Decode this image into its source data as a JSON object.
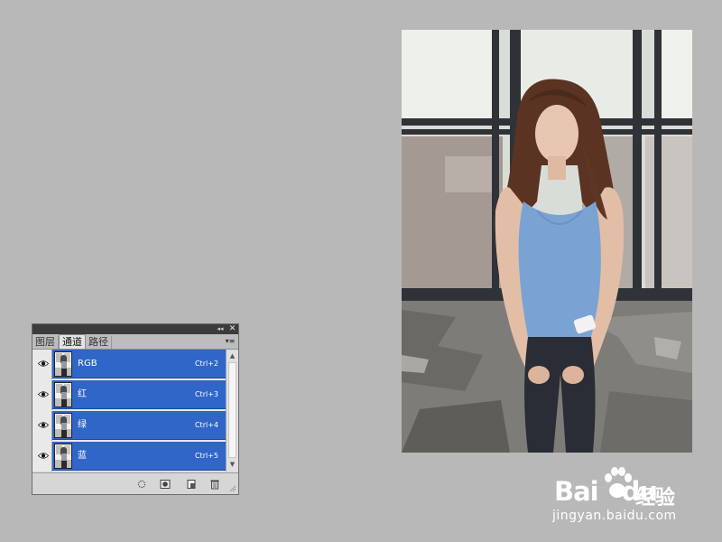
{
  "panel": {
    "tabs": [
      {
        "label": "图层",
        "active": false
      },
      {
        "label": "通道",
        "active": true
      },
      {
        "label": "路径",
        "active": false
      }
    ],
    "collapse_glyph": "◂◂",
    "close_glyph": "✕",
    "menu_glyph": "▾≡",
    "channels": [
      {
        "name": "RGB",
        "shortcut": "Ctrl+2",
        "visible": true,
        "selected": true
      },
      {
        "name": "红",
        "shortcut": "Ctrl+3",
        "visible": true,
        "selected": true
      },
      {
        "name": "绿",
        "shortcut": "Ctrl+4",
        "visible": true,
        "selected": true
      },
      {
        "name": "蓝",
        "shortcut": "Ctrl+5",
        "visible": true,
        "selected": true
      }
    ],
    "selection_color": "#3066c8",
    "footer_icons": [
      "load-selection-icon",
      "save-selection-icon",
      "new-channel-icon",
      "delete-channel-icon"
    ]
  },
  "watermark": {
    "brand_left": "Bai",
    "brand_right": "du",
    "brand_cn": "经验",
    "url": "jingyan.baidu.com"
  }
}
